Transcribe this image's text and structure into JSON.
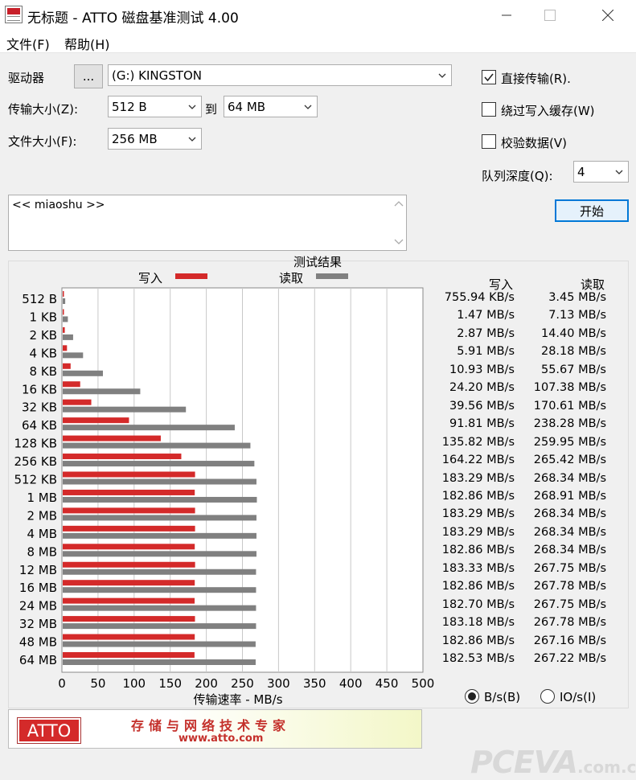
{
  "window": {
    "title": "无标题 - ATTO 磁盘基准测试 4.00"
  },
  "menu": [
    "文件(F)",
    "帮助(H)"
  ],
  "settings": {
    "drive_label": "驱动器",
    "browse_label": "...",
    "drive_value": "(G:) KINGSTON",
    "transfer_label": "传输大小(Z):",
    "transfer_from": "512 B",
    "to_label": "到",
    "transfer_to": "64 MB",
    "filesize_label": "文件大小(F):",
    "filesize_value": "256 MB",
    "direct_io_label": "直接传输(R).",
    "direct_io_checked": true,
    "bypass_cache_label": "绕过写入缓存(W)",
    "bypass_cache_checked": false,
    "verify_label": "校验数据(V)",
    "verify_checked": false,
    "queue_label": "队列深度(Q):",
    "queue_value": "4",
    "start_label": "开始",
    "description": "<< miaoshu >>"
  },
  "results": {
    "title": "测试结果",
    "legend_write": "写入",
    "legend_read": "读取",
    "col_write": "写入",
    "col_read": "读取",
    "units_bs": "B/s(B)",
    "units_ios": "IO/s(I)",
    "units_selected": "B/s"
  },
  "chart_data": {
    "type": "bar",
    "orientation": "horizontal",
    "xlabel": "传输速率 - MB/s",
    "xlim": [
      0,
      500
    ],
    "xticks": [
      0,
      50,
      100,
      150,
      200,
      250,
      300,
      350,
      400,
      450,
      500
    ],
    "grid": true,
    "categories": [
      "512 B",
      "1 KB",
      "2 KB",
      "4 KB",
      "8 KB",
      "16 KB",
      "32 KB",
      "64 KB",
      "128 KB",
      "256 KB",
      "512 KB",
      "1 MB",
      "2 MB",
      "4 MB",
      "8 MB",
      "12 MB",
      "16 MB",
      "24 MB",
      "32 MB",
      "48 MB",
      "64 MB"
    ],
    "series": [
      {
        "name": "写入",
        "color": "#d42a2a",
        "values": [
          0.74,
          1.47,
          2.87,
          5.91,
          10.93,
          24.2,
          39.56,
          91.81,
          135.82,
          164.22,
          183.29,
          182.86,
          183.29,
          183.29,
          182.86,
          183.33,
          182.86,
          182.7,
          183.18,
          182.86,
          182.53
        ],
        "labels": [
          "755.94 KB/s",
          "1.47 MB/s",
          "2.87 MB/s",
          "5.91 MB/s",
          "10.93 MB/s",
          "24.20 MB/s",
          "39.56 MB/s",
          "91.81 MB/s",
          "135.82 MB/s",
          "164.22 MB/s",
          "183.29 MB/s",
          "182.86 MB/s",
          "183.29 MB/s",
          "183.29 MB/s",
          "182.86 MB/s",
          "183.33 MB/s",
          "182.86 MB/s",
          "182.70 MB/s",
          "183.18 MB/s",
          "182.86 MB/s",
          "182.53 MB/s"
        ]
      },
      {
        "name": "读取",
        "color": "#808080",
        "values": [
          3.45,
          7.13,
          14.4,
          28.18,
          55.67,
          107.38,
          170.61,
          238.28,
          259.95,
          265.42,
          268.34,
          268.91,
          268.34,
          268.34,
          268.34,
          267.75,
          267.78,
          267.75,
          267.78,
          267.16,
          267.22
        ],
        "labels": [
          "3.45 MB/s",
          "7.13 MB/s",
          "14.40 MB/s",
          "28.18 MB/s",
          "55.67 MB/s",
          "107.38 MB/s",
          "170.61 MB/s",
          "238.28 MB/s",
          "259.95 MB/s",
          "265.42 MB/s",
          "268.34 MB/s",
          "268.91 MB/s",
          "268.34 MB/s",
          "268.34 MB/s",
          "268.34 MB/s",
          "267.75 MB/s",
          "267.78 MB/s",
          "267.75 MB/s",
          "267.78 MB/s",
          "267.16 MB/s",
          "267.22 MB/s"
        ]
      }
    ]
  },
  "banner": {
    "logo_text": "ATTO",
    "slogan": "存储与网络技术专家",
    "url": "www.atto.com"
  },
  "watermark": {
    "main": "PCEVA",
    "suffix": ".com.cn"
  }
}
